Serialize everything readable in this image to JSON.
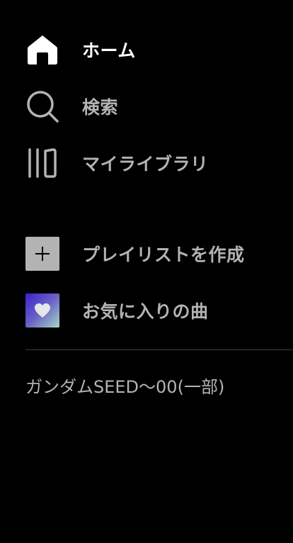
{
  "nav": {
    "home_label": "ホーム",
    "search_label": "検索",
    "library_label": "マイライブラリ"
  },
  "actions": {
    "create_playlist_label": "プレイリストを作成",
    "liked_songs_label": "お気に入りの曲"
  },
  "playlists": [
    {
      "name": "ガンダムSEED〜00(一部)"
    }
  ],
  "colors": {
    "background": "#000000",
    "active_text": "#ffffff",
    "inactive_text": "#b3b3b3",
    "liked_gradient_start": "#3e1fd0",
    "liked_gradient_end": "#a8d8c8"
  },
  "icons": {
    "home": "home-icon",
    "search": "search-icon",
    "library": "library-icon",
    "create": "plus-icon",
    "liked": "heart-icon"
  }
}
